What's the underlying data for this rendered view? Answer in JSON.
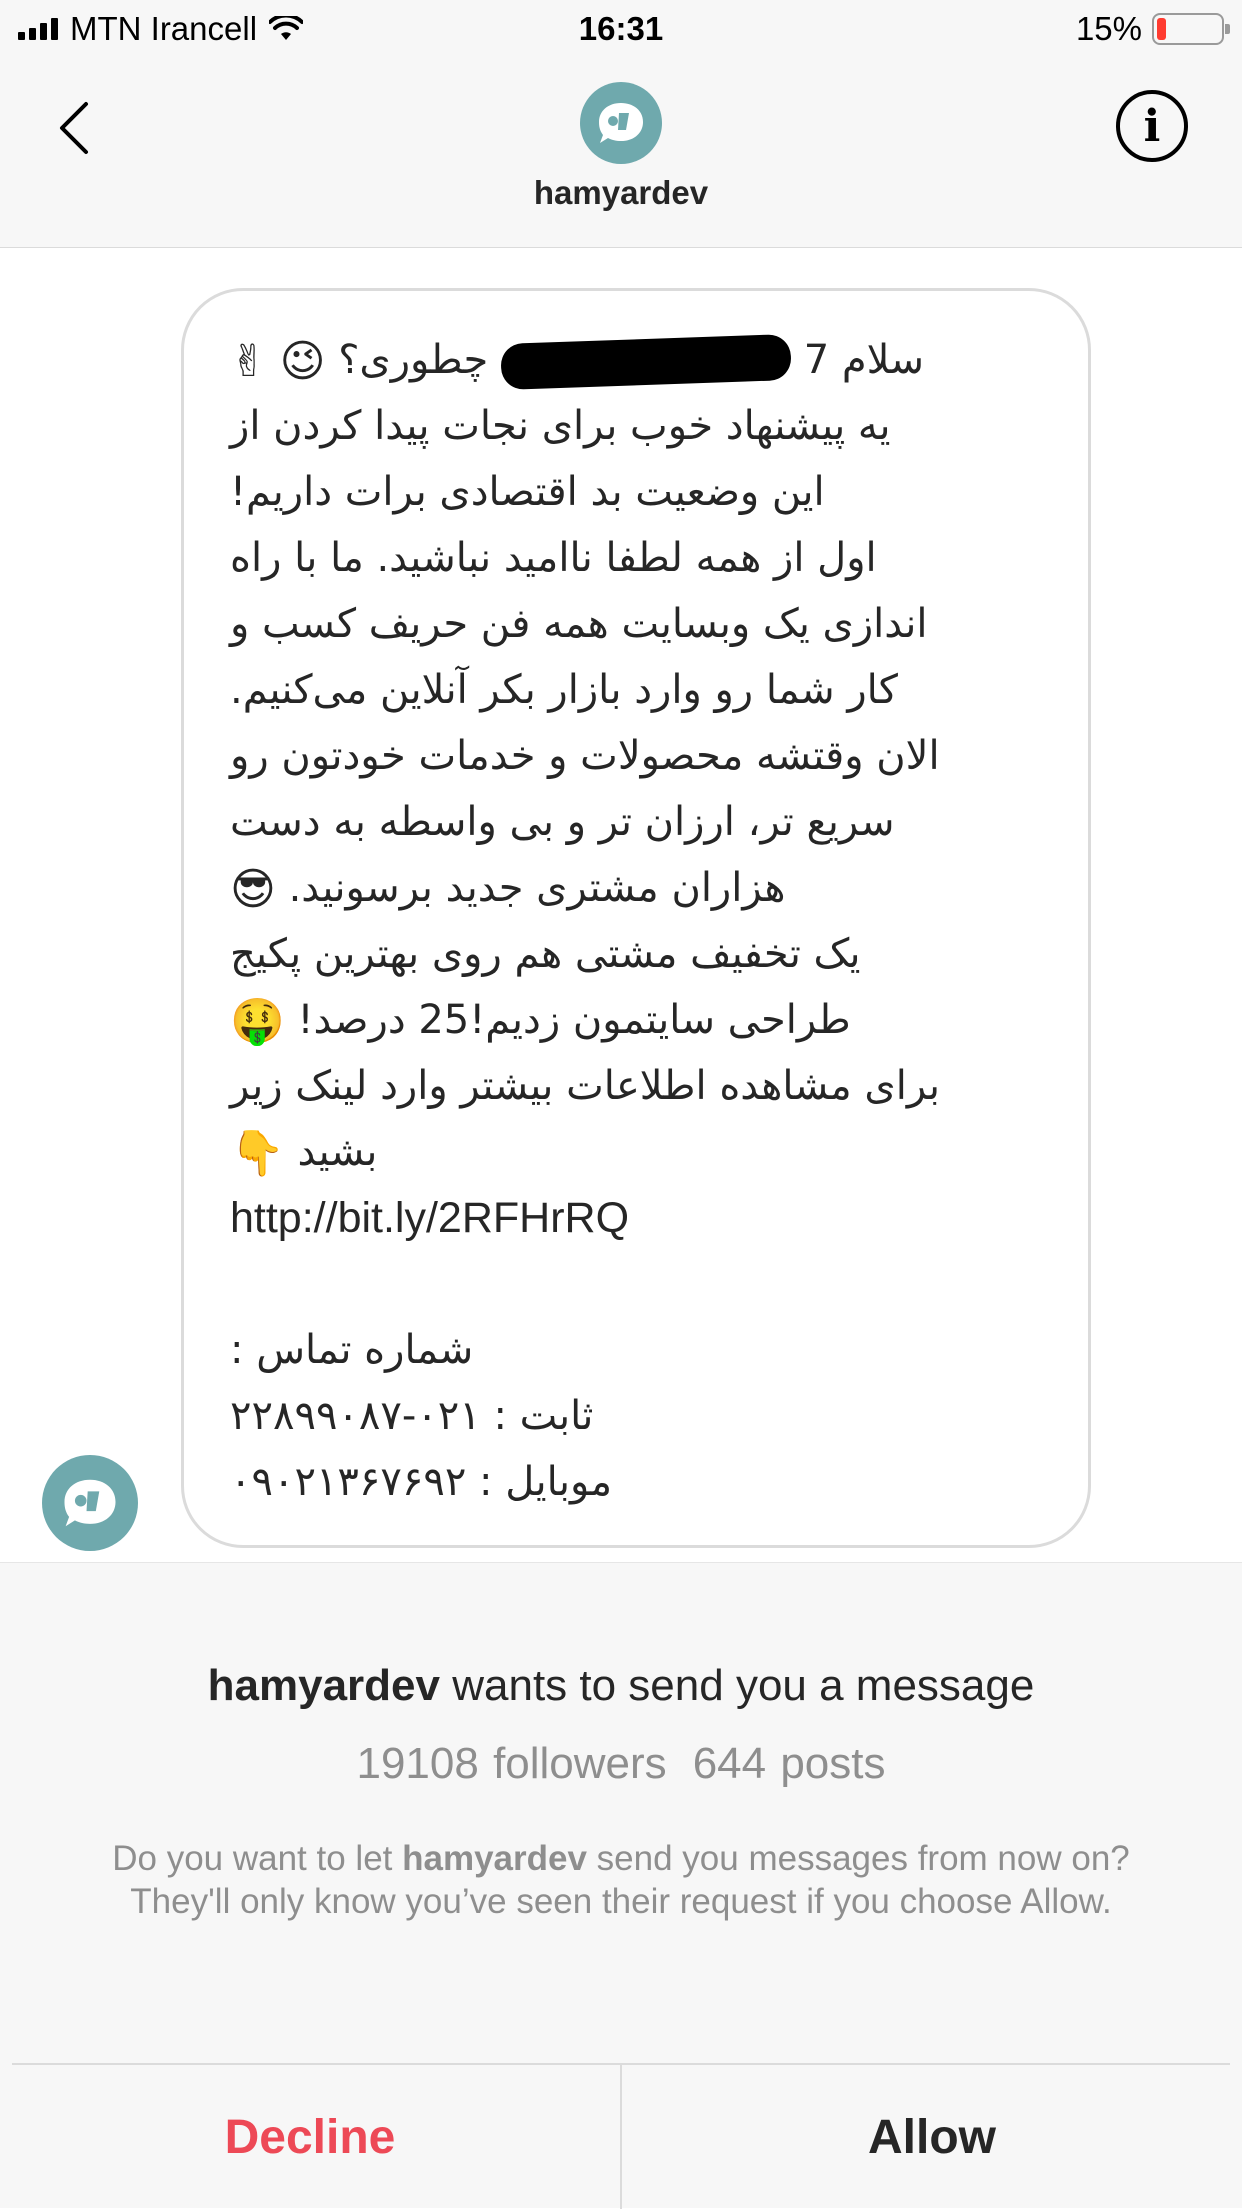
{
  "status_bar": {
    "carrier": "MTN Irancell",
    "time": "16:31",
    "battery_percent": "15%",
    "battery_level": 0.15,
    "battery_color": "#ff3b30"
  },
  "header": {
    "username": "hamyardev",
    "back_icon": "chevron-left-icon",
    "info_icon": "info-circle-icon",
    "info_glyph": "i",
    "avatar_color": "#6fa9ad"
  },
  "message": {
    "lines": [
      "سلام 7",
      "چطوری؟",
      "یه پیشنهاد خوب برای نجات پیدا کردن از",
      "این وضعیت بد اقتصادی برات داریم!",
      "اول از همه لطفا ناامید نباشید. ما با راه",
      "اندازی یک وبسایت همه فن حریف کسب و",
      "کار شما رو وارد بازار بکر آنلاین می‌کنیم.",
      "الان وقتشه محصولات و خدمات خودتون رو",
      "سریع تر، ارزان تر و بی واسطه به دست",
      "هزاران مشتری جدید برسونید.",
      "یک تخفیف مشتی هم روی بهترین پکیج",
      "طراحی سایتمون زدیم!25 درصد!",
      "برای مشاهده اطلاعات بیشتر وارد لینک زیر",
      "بشید",
      "http://bit.ly/2RFHrRQ",
      "",
      "شماره تماس :",
      "ثابت : ۰۲۱-۲۲۸۹۹۰۸۷",
      "موبایل : ۰۹۰۲۱۳۶۷۶۹۲"
    ],
    "emojis": {
      "wink": "😉",
      "victory": "✌",
      "sunglasses": "😎",
      "money_mouth": "🤑",
      "point_down": "👇"
    }
  },
  "request": {
    "username": "hamyardev",
    "title_suffix": " wants to send you a message",
    "followers": "19108 followers",
    "posts": "644 posts",
    "desc_prefix": "Do you want to let ",
    "desc_username": "hamyardev",
    "desc_suffix": " send you messages from now on? They'll only know you’ve seen their request if you choose Allow.",
    "decline_label": "Decline",
    "allow_label": "Allow",
    "decline_color": "#ed4956"
  }
}
